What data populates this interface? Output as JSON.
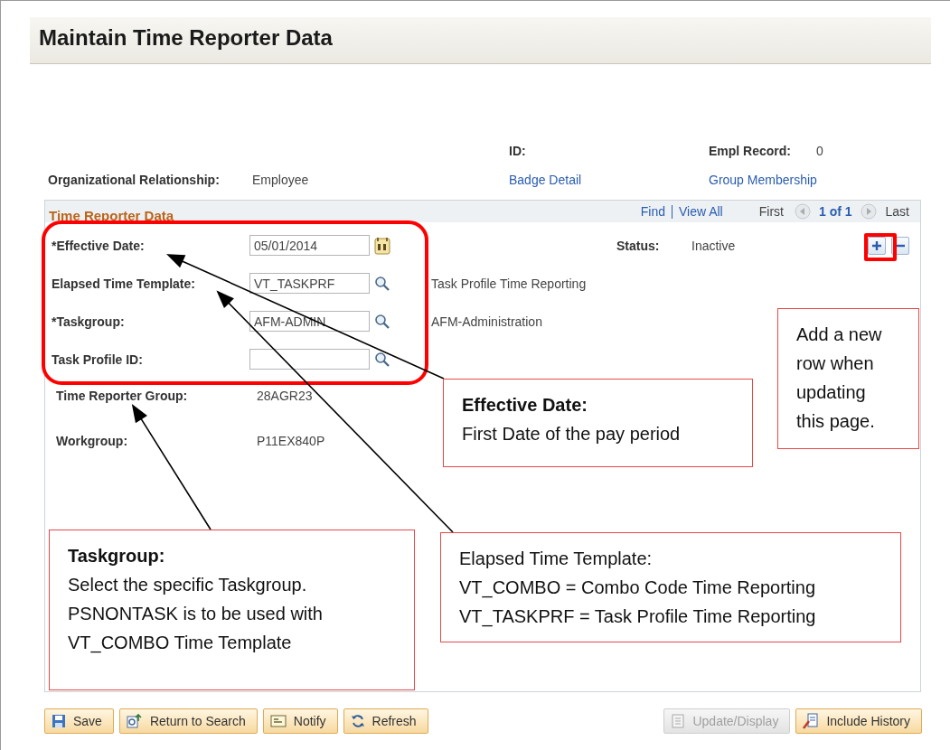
{
  "window": {
    "title": "Maintain Time Reporter Data"
  },
  "header": {
    "id_label": "ID:",
    "empl_record_label": "Empl Record:",
    "empl_record_value": "0",
    "org_relationship_label": "Organizational Relationship:",
    "org_relationship_value": "Employee",
    "links": [
      "Badge Detail",
      "Group Membership"
    ]
  },
  "panel": {
    "title": "Time Reporter Data",
    "find": "Find",
    "view_all": "View All",
    "first": "First",
    "position": "1 of 1",
    "last": "Last",
    "status_label": "Status:",
    "status_value": "Inactive",
    "fields": [
      {
        "label": "*Effective Date:",
        "value": "05/01/2014",
        "kind": "date"
      },
      {
        "label": "Elapsed Time Template:",
        "value": "VT_TASKPRF",
        "kind": "prompt",
        "description": "Task Profile Time Reporting"
      },
      {
        "label": "*Taskgroup:",
        "value": "AFM-ADMIN",
        "kind": "prompt",
        "description": "AFM-Administration"
      },
      {
        "label": "Task Profile ID:",
        "kind": "prompt"
      }
    ],
    "info": [
      {
        "label": "Time Reporter Group:",
        "value": "28AGR23"
      },
      {
        "label": "Workgroup:",
        "value": "P11EX840P"
      }
    ]
  },
  "toolbar": {
    "left": [
      {
        "label": "Save",
        "kind": "save",
        "disabled": false
      },
      {
        "label": "Return to Search",
        "kind": "return",
        "disabled": false
      },
      {
        "label": "Notify",
        "kind": "notify",
        "disabled": false
      },
      {
        "label": "Refresh",
        "kind": "refresh",
        "disabled": false
      }
    ],
    "right": [
      {
        "label": "Update/Display",
        "kind": "update",
        "disabled": true
      },
      {
        "label": "Include History",
        "kind": "history",
        "disabled": false
      }
    ]
  },
  "callouts": [
    {
      "text": "Add a new row when updating this page."
    },
    {
      "text": "**Effective Date:**\nFirst Date of the pay period"
    },
    {
      "text": "**Taskgroup:**\nSelect the specific Taskgroup.\nPSNONTASK is to be used with\nVT_COMBO Time Template"
    },
    {
      "text": "Elapsed Time Template:\nVT_COMBO = Combo Code Time Reporting\nVT_TASKPRF = Task Profile Time Reporting"
    }
  ]
}
